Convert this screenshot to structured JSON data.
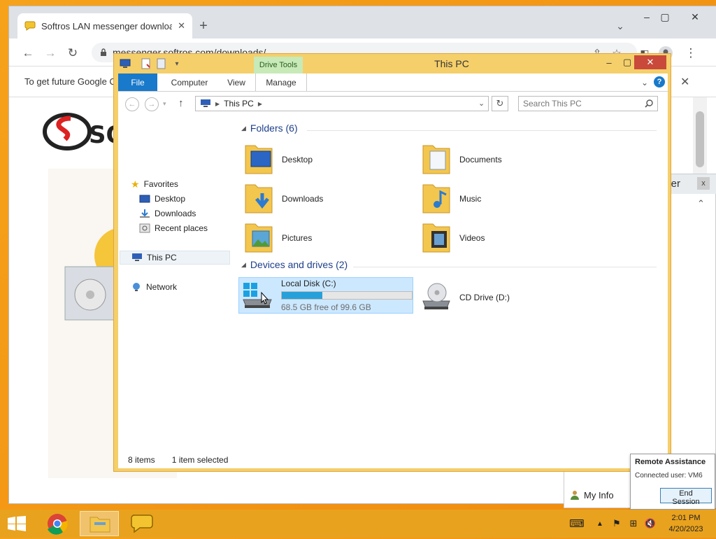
{
  "browser": {
    "tab_title": "Softros LAN messenger downloa",
    "url": "messenger.softros.com/downloads/",
    "infobar_text": "To get future Google C",
    "logo_text": "SO"
  },
  "lan_window": {
    "title_fragment": "nger",
    "my_info": "My Info"
  },
  "explorer": {
    "title": "This PC",
    "context_tab": "Drive Tools",
    "ribbon_tabs": [
      "File",
      "Computer",
      "View",
      "Manage"
    ],
    "address": "This PC",
    "search_placeholder": "Search This PC",
    "nav": {
      "favorites": "Favorites",
      "desktop": "Desktop",
      "downloads": "Downloads",
      "recent": "Recent places",
      "this_pc": "This PC",
      "network": "Network"
    },
    "folders_header": "Folders (6)",
    "folders": [
      "Desktop",
      "Documents",
      "Downloads",
      "Music",
      "Pictures",
      "Videos"
    ],
    "devices_header": "Devices and drives (2)",
    "drives": [
      {
        "name": "Local Disk (C:)",
        "free": "68.5 GB free of 99.6 GB",
        "used_fraction": 0.312
      },
      {
        "name": "CD Drive (D:)"
      }
    ],
    "status_items": "8 items",
    "status_selected": "1 item selected"
  },
  "remote_assistance": {
    "title": "Remote Assistance",
    "connected": "Connected user:  VM6",
    "end_session": "End Session"
  },
  "taskbar": {
    "time": "2:01 PM",
    "date": "4/20/2023"
  },
  "colors": {
    "accent": "#1979ca",
    "selection": "#cce8ff",
    "folder_yellow": "#f3c64e",
    "desktop_orange": "#f39a16"
  }
}
